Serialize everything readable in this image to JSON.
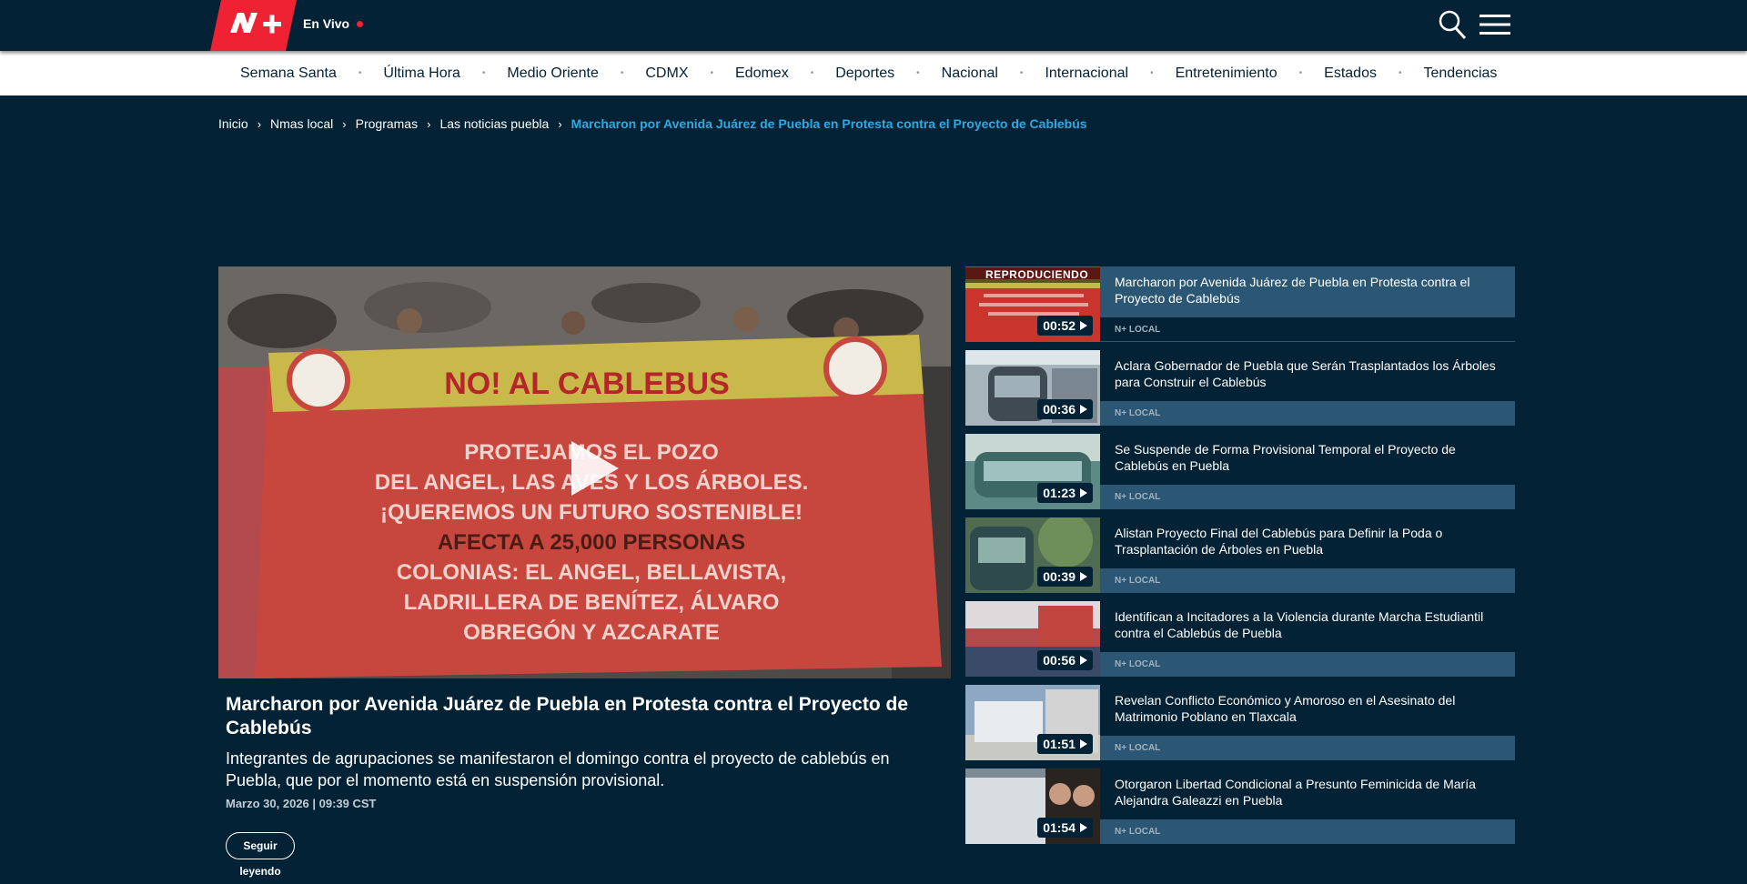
{
  "header": {
    "logo_text": "N+",
    "live_label": "En Vivo"
  },
  "nav": {
    "items": [
      "Semana Santa",
      "Última Hora",
      "Medio Oriente",
      "CDMX",
      "Edomex",
      "Deportes",
      "Nacional",
      "Internacional",
      "Entretenimiento",
      "Estados",
      "Tendencias"
    ]
  },
  "breadcrumb": {
    "items": [
      "Inicio",
      "Nmas local",
      "Programas",
      "Las noticias puebla"
    ],
    "current": "Marcharon por Avenida Juárez de Puebla en Protesta contra el Proyecto de Cablebús"
  },
  "video": {
    "banner_line1": "NO! AL CABLEBUS",
    "banner_line2": "PROTEJAMOS EL POZO",
    "banner_line3": "DEL ANGEL, LAS AVES Y LOS ÁRBOLES.",
    "banner_line4": "¡QUEREMOS UN FUTURO SOSTENIBLE!",
    "banner_line5": "AFECTA A 25,000 PERSONAS",
    "banner_line6": "COLONIAS: EL ANGEL, BELLAVISTA,",
    "banner_line7": "LADRILLERA DE BENÍTEZ, ÁLVARO",
    "banner_line8": "OBREGÓN Y AZCARATE",
    "title": "Marcharon por Avenida Juárez de Puebla en Protesta contra el Proyecto de Cablebús",
    "description": "Integrantes de agrupaciones se manifestaron el domingo contra el proyecto de cablebús en Puebla, que por el momento está en suspensión provisional.",
    "date": "Marzo 30, 2026 | 09:39 CST",
    "follow_label": "Seguir leyendo"
  },
  "playlist": {
    "now_playing_label": "REPRODUCIENDO",
    "items": [
      {
        "title": "Marcharon por Avenida Juárez de Puebla en Protesta contra el Proyecto de Cablebús",
        "duration": "00:52",
        "tag": "N+ LOCAL",
        "thumb_color": "#c9342c"
      },
      {
        "title": "Aclara Gobernador de Puebla que Serán Trasplantados los Árboles para Construir el Cablebús",
        "duration": "00:36",
        "tag": "N+ LOCAL",
        "thumb_color": "#a8b4bb"
      },
      {
        "title": "Se Suspende de Forma Provisional Temporal el Proyecto de Cablebús en Puebla",
        "duration": "01:23",
        "tag": "N+ LOCAL",
        "thumb_color": "#5d8a86"
      },
      {
        "title": "Alistan Proyecto Final del Cablebús para Definir la Poda o Trasplantación de Árboles en Puebla",
        "duration": "00:39",
        "tag": "N+ LOCAL",
        "thumb_color": "#4f6b52"
      },
      {
        "title": "Identifican a Incitadores a la Violencia durante Marcha Estudiantil contra el Cablebús de Puebla",
        "duration": "00:56",
        "tag": "N+ LOCAL",
        "thumb_color": "#b5484a"
      },
      {
        "title": "Revelan Conflicto Económico y Amoroso en el Asesinato del Matrimonio Poblano en Tlaxcala",
        "duration": "01:51",
        "tag": "N+ LOCAL",
        "thumb_color": "#8ea7c3"
      },
      {
        "title": "Otorgaron Libertad Condicional a Presunto Feminicida de María Alejandra Galeazzi en Puebla",
        "duration": "01:54",
        "tag": "N+ LOCAL",
        "thumb_color": "#7e8a96"
      }
    ]
  },
  "colors": {
    "background": "#032235",
    "brand_red": "#ee2233",
    "accent_blue": "#30a8e0",
    "tag_bar": "#2b5674"
  }
}
